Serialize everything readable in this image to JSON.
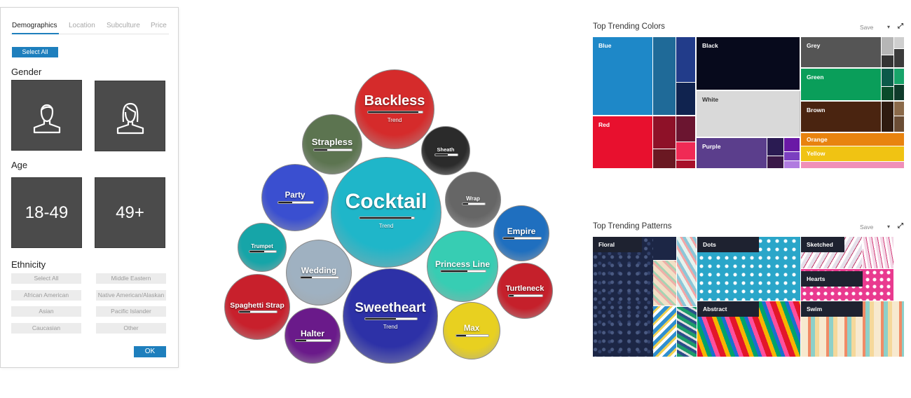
{
  "filter_panel": {
    "tabs": [
      "Demographics",
      "Location",
      "Subculture",
      "Price"
    ],
    "select_all_button": "Select All",
    "gender": {
      "title": "Gender",
      "options": [
        "male-icon",
        "female-icon"
      ]
    },
    "age": {
      "title": "Age",
      "options": [
        "18-49",
        "49+"
      ]
    },
    "ethnicity": {
      "title": "Ethnicity",
      "options": [
        "Select All",
        "Middle Eastern",
        "African American",
        "Native American/Alaskan",
        "Asian",
        "Pacific Islander",
        "Caucasian",
        "Other"
      ]
    },
    "ok_button": "OK"
  },
  "bubbles": [
    {
      "label": "Backless",
      "sub": "Trend",
      "trend": 0.92,
      "color": "#d52b2b"
    },
    {
      "label": "Strapless",
      "trend": 0.35,
      "color": "#5c7450"
    },
    {
      "label": "Sheath",
      "trend": 0.55,
      "color": "#2b2b2b"
    },
    {
      "label": "Party",
      "trend": 0.4,
      "color": "#3a4fd0"
    },
    {
      "label": "Cocktail",
      "sub": "Trend",
      "trend": 0.95,
      "color": "#1fb6c9"
    },
    {
      "label": "Wrap",
      "trend": 0.25,
      "color": "#666666"
    },
    {
      "label": "Empire",
      "trend": 0.3,
      "color": "#1f6fbf"
    },
    {
      "label": "Trumpet",
      "trend": 0.55,
      "color": "#16a5a8"
    },
    {
      "label": "Wedding",
      "trend": 0.3,
      "color": "#9fb1c1"
    },
    {
      "label": "Princess Line",
      "trend": 0.6,
      "color": "#37cdb3"
    },
    {
      "label": "Turtleneck",
      "trend": 0.15,
      "color": "#c5202b"
    },
    {
      "label": "Spaghetti Strap",
      "trend": 0.3,
      "color": "#c8202c"
    },
    {
      "label": "Sweetheart",
      "sub": "Trend",
      "trend": 0.6,
      "color": "#2d31a7"
    },
    {
      "label": "Halter",
      "trend": 0.3,
      "color": "#6a1a8a"
    },
    {
      "label": "Max",
      "trend": 0.3,
      "color": "#e8d020"
    }
  ],
  "colors_panel": {
    "title": "Top Trending Colors",
    "save": "Save",
    "cells": [
      {
        "label": "Blue",
        "color": "#1e88c8"
      },
      {
        "label": "Black",
        "color": "#070a1c"
      },
      {
        "label": "Grey",
        "color": "#555555"
      },
      {
        "label": "White",
        "color": "#d9d9d9"
      },
      {
        "label": "Green",
        "color": "#0a9e5a"
      },
      {
        "label": "Red",
        "color": "#e8102e"
      },
      {
        "label": "Brown",
        "color": "#4a2410"
      },
      {
        "label": "Purple",
        "color": "#5b3e8c"
      },
      {
        "label": "Orange",
        "color": "#e8830f"
      },
      {
        "label": "Yellow",
        "color": "#f0c313"
      }
    ]
  },
  "patterns_panel": {
    "title": "Top Trending Patterns",
    "save": "Save",
    "cells": [
      {
        "label": "Floral"
      },
      {
        "label": "Dots"
      },
      {
        "label": "Sketched"
      },
      {
        "label": "Hearts"
      },
      {
        "label": "Abstract"
      },
      {
        "label": "Swim"
      }
    ]
  }
}
